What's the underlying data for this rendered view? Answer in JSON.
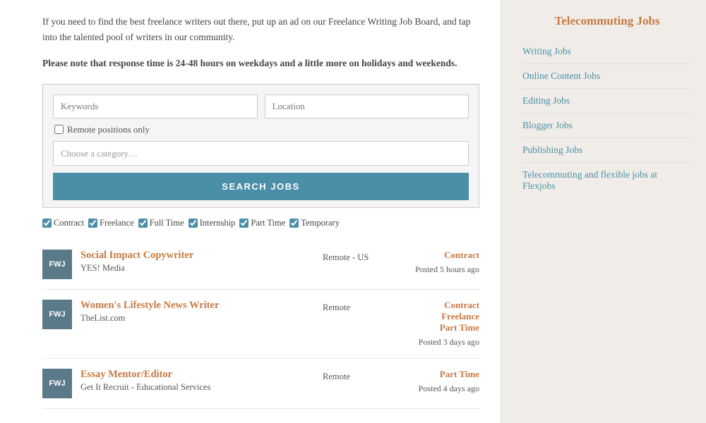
{
  "intro": {
    "text": "If you need to find the best freelance writers out there, put up an ad on our Freelance Writing Job Board, and tap into the talented pool of writers in our community.",
    "notice": "Please note that response time is 24-48 hours on weekdays and a little more on holidays and weekends."
  },
  "search": {
    "keywords_placeholder": "Keywords",
    "location_placeholder": "Location",
    "remote_label": "Remote positions only",
    "category_placeholder": "Choose a category…",
    "search_button": "SEARCH JOBS"
  },
  "filters": [
    {
      "label": "Contract",
      "checked": true
    },
    {
      "label": "Freelance",
      "checked": true
    },
    {
      "label": "Full Time",
      "checked": true
    },
    {
      "label": "Internship",
      "checked": true
    },
    {
      "label": "Part Time",
      "checked": true
    },
    {
      "label": "Temporary",
      "checked": true
    }
  ],
  "jobs": [
    {
      "logo": "FWJ",
      "title": "Social Impact Copywriter",
      "company": "YES! Media",
      "location": "Remote - US",
      "types": [
        "Contract"
      ],
      "posted": "Posted 5 hours ago"
    },
    {
      "logo": "FWJ",
      "title": "Women's Lifestyle News Writer",
      "company": "TheList.com",
      "location": "Remote",
      "types": [
        "Contract",
        "Freelance",
        "Part Time"
      ],
      "posted": "Posted 3 days ago"
    },
    {
      "logo": "FWJ",
      "title": "Essay Mentor/Editor",
      "company": "Get It Recruit - Educational Services",
      "location": "Remote",
      "types": [
        "Part Time"
      ],
      "posted": "Posted 4 days ago"
    }
  ],
  "sidebar": {
    "title": "Telecommuting Jobs",
    "links": [
      {
        "label": "Writing Jobs"
      },
      {
        "label": "Online Content Jobs"
      },
      {
        "label": "Editing Jobs"
      },
      {
        "label": "Blogger Jobs"
      },
      {
        "label": "Publishing Jobs"
      },
      {
        "label": "Telecommuting and flexible jobs at Flexjobs"
      }
    ]
  }
}
